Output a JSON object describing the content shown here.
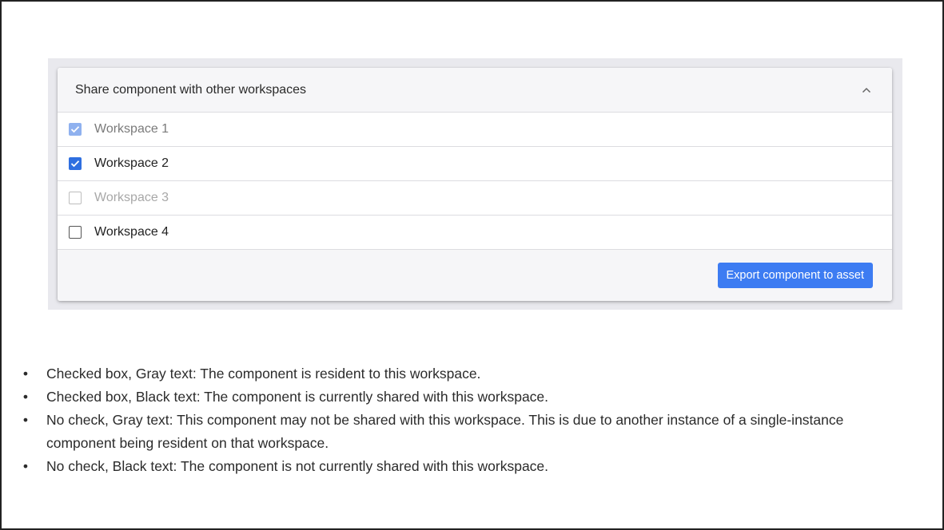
{
  "panel": {
    "title": "Share component with other workspaces",
    "collapse_icon": "chevron-up-icon",
    "workspaces": [
      {
        "label": "Workspace 1",
        "checked": true,
        "disabled": true
      },
      {
        "label": "Workspace 2",
        "checked": true,
        "disabled": false
      },
      {
        "label": "Workspace 3",
        "checked": false,
        "disabled": true
      },
      {
        "label": "Workspace 4",
        "checked": false,
        "disabled": false
      }
    ],
    "export_button": "Export component to asset"
  },
  "notes": [
    {
      "bullet": "•",
      "text": "Checked box, Gray text: The component is resident to this workspace."
    },
    {
      "bullet": "•",
      "text": "Checked box, Black text: The component is currently shared with this workspace."
    },
    {
      "bullet": "•",
      "text": "No check, Gray text: This component may not be shared with this workspace. This is due to another instance of a single-instance component being resident on that workspace."
    },
    {
      "bullet": "•",
      "text": "No check, Black text: The component is not currently shared with this workspace."
    }
  ],
  "colors": {
    "accent": "#3d7cf2",
    "checkbox_checked": "#2f6fe0",
    "checkbox_checked_disabled": "#8fb1ef"
  }
}
